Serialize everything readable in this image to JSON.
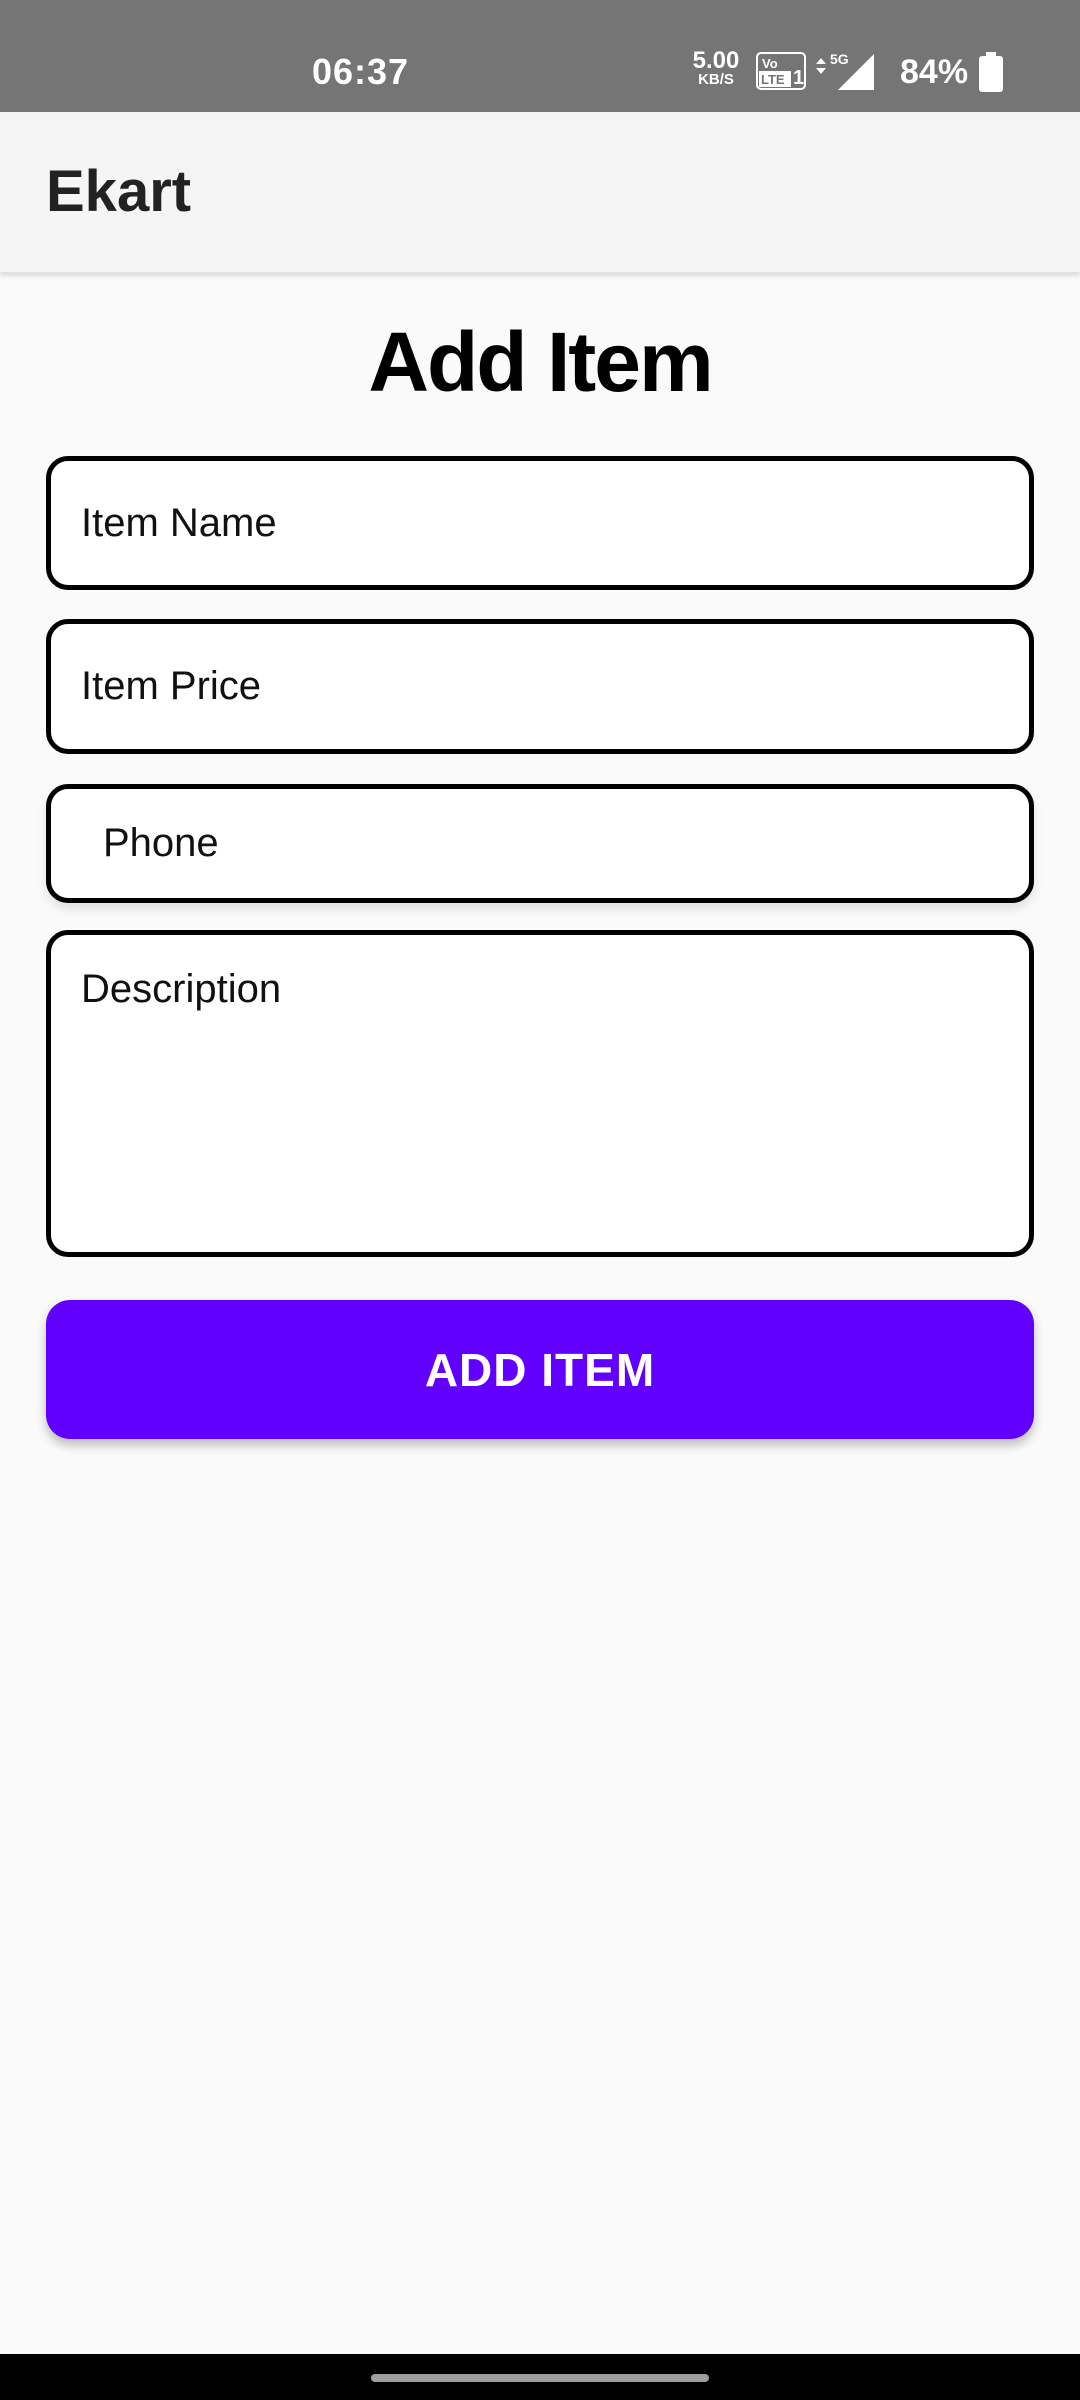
{
  "status_bar": {
    "time": "06:37",
    "net_speed_value": "5.00",
    "net_speed_unit": "KB/S",
    "network_type": "5G",
    "battery_percent": "84%",
    "icons": [
      "volte-icon",
      "signal-icon",
      "battery-icon"
    ]
  },
  "app_bar": {
    "title": "Ekart"
  },
  "page": {
    "title": "Add Item"
  },
  "form": {
    "item_name_placeholder": "Item Name",
    "item_name_value": "",
    "item_price_placeholder": "Item Price",
    "item_price_value": "",
    "phone_placeholder": "Phone",
    "phone_value": "",
    "description_placeholder": "Description",
    "description_value": "",
    "submit_label": "ADD ITEM"
  },
  "colors": {
    "accent": "#6200ff",
    "status_bar": "#757575",
    "app_bar": "#f5f5f5",
    "background": "#fafafa"
  }
}
